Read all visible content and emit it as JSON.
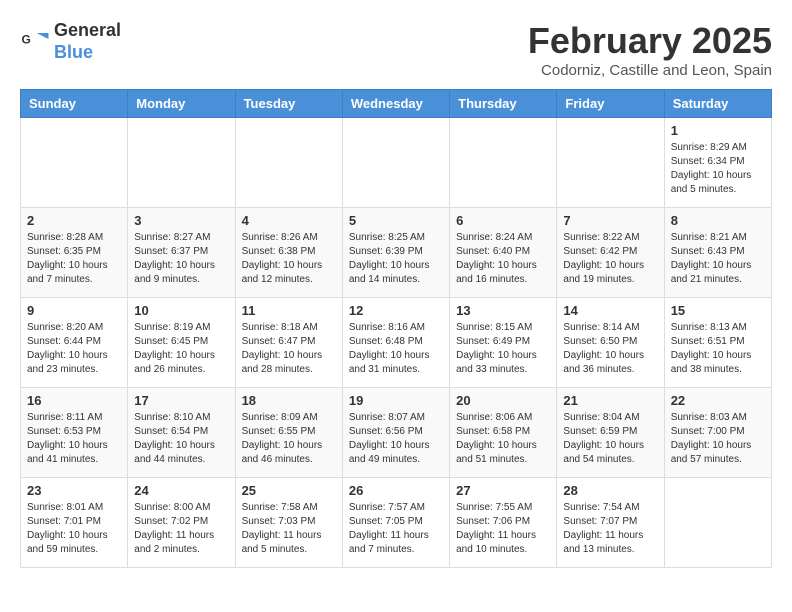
{
  "header": {
    "logo_line1": "General",
    "logo_line2": "Blue",
    "month": "February 2025",
    "location": "Codorniz, Castille and Leon, Spain"
  },
  "weekdays": [
    "Sunday",
    "Monday",
    "Tuesday",
    "Wednesday",
    "Thursday",
    "Friday",
    "Saturday"
  ],
  "weeks": [
    [
      {
        "day": "",
        "info": ""
      },
      {
        "day": "",
        "info": ""
      },
      {
        "day": "",
        "info": ""
      },
      {
        "day": "",
        "info": ""
      },
      {
        "day": "",
        "info": ""
      },
      {
        "day": "",
        "info": ""
      },
      {
        "day": "1",
        "info": "Sunrise: 8:29 AM\nSunset: 6:34 PM\nDaylight: 10 hours\nand 5 minutes."
      }
    ],
    [
      {
        "day": "2",
        "info": "Sunrise: 8:28 AM\nSunset: 6:35 PM\nDaylight: 10 hours\nand 7 minutes."
      },
      {
        "day": "3",
        "info": "Sunrise: 8:27 AM\nSunset: 6:37 PM\nDaylight: 10 hours\nand 9 minutes."
      },
      {
        "day": "4",
        "info": "Sunrise: 8:26 AM\nSunset: 6:38 PM\nDaylight: 10 hours\nand 12 minutes."
      },
      {
        "day": "5",
        "info": "Sunrise: 8:25 AM\nSunset: 6:39 PM\nDaylight: 10 hours\nand 14 minutes."
      },
      {
        "day": "6",
        "info": "Sunrise: 8:24 AM\nSunset: 6:40 PM\nDaylight: 10 hours\nand 16 minutes."
      },
      {
        "day": "7",
        "info": "Sunrise: 8:22 AM\nSunset: 6:42 PM\nDaylight: 10 hours\nand 19 minutes."
      },
      {
        "day": "8",
        "info": "Sunrise: 8:21 AM\nSunset: 6:43 PM\nDaylight: 10 hours\nand 21 minutes."
      }
    ],
    [
      {
        "day": "9",
        "info": "Sunrise: 8:20 AM\nSunset: 6:44 PM\nDaylight: 10 hours\nand 23 minutes."
      },
      {
        "day": "10",
        "info": "Sunrise: 8:19 AM\nSunset: 6:45 PM\nDaylight: 10 hours\nand 26 minutes."
      },
      {
        "day": "11",
        "info": "Sunrise: 8:18 AM\nSunset: 6:47 PM\nDaylight: 10 hours\nand 28 minutes."
      },
      {
        "day": "12",
        "info": "Sunrise: 8:16 AM\nSunset: 6:48 PM\nDaylight: 10 hours\nand 31 minutes."
      },
      {
        "day": "13",
        "info": "Sunrise: 8:15 AM\nSunset: 6:49 PM\nDaylight: 10 hours\nand 33 minutes."
      },
      {
        "day": "14",
        "info": "Sunrise: 8:14 AM\nSunset: 6:50 PM\nDaylight: 10 hours\nand 36 minutes."
      },
      {
        "day": "15",
        "info": "Sunrise: 8:13 AM\nSunset: 6:51 PM\nDaylight: 10 hours\nand 38 minutes."
      }
    ],
    [
      {
        "day": "16",
        "info": "Sunrise: 8:11 AM\nSunset: 6:53 PM\nDaylight: 10 hours\nand 41 minutes."
      },
      {
        "day": "17",
        "info": "Sunrise: 8:10 AM\nSunset: 6:54 PM\nDaylight: 10 hours\nand 44 minutes."
      },
      {
        "day": "18",
        "info": "Sunrise: 8:09 AM\nSunset: 6:55 PM\nDaylight: 10 hours\nand 46 minutes."
      },
      {
        "day": "19",
        "info": "Sunrise: 8:07 AM\nSunset: 6:56 PM\nDaylight: 10 hours\nand 49 minutes."
      },
      {
        "day": "20",
        "info": "Sunrise: 8:06 AM\nSunset: 6:58 PM\nDaylight: 10 hours\nand 51 minutes."
      },
      {
        "day": "21",
        "info": "Sunrise: 8:04 AM\nSunset: 6:59 PM\nDaylight: 10 hours\nand 54 minutes."
      },
      {
        "day": "22",
        "info": "Sunrise: 8:03 AM\nSunset: 7:00 PM\nDaylight: 10 hours\nand 57 minutes."
      }
    ],
    [
      {
        "day": "23",
        "info": "Sunrise: 8:01 AM\nSunset: 7:01 PM\nDaylight: 10 hours\nand 59 minutes."
      },
      {
        "day": "24",
        "info": "Sunrise: 8:00 AM\nSunset: 7:02 PM\nDaylight: 11 hours\nand 2 minutes."
      },
      {
        "day": "25",
        "info": "Sunrise: 7:58 AM\nSunset: 7:03 PM\nDaylight: 11 hours\nand 5 minutes."
      },
      {
        "day": "26",
        "info": "Sunrise: 7:57 AM\nSunset: 7:05 PM\nDaylight: 11 hours\nand 7 minutes."
      },
      {
        "day": "27",
        "info": "Sunrise: 7:55 AM\nSunset: 7:06 PM\nDaylight: 11 hours\nand 10 minutes."
      },
      {
        "day": "28",
        "info": "Sunrise: 7:54 AM\nSunset: 7:07 PM\nDaylight: 11 hours\nand 13 minutes."
      },
      {
        "day": "",
        "info": ""
      }
    ]
  ]
}
